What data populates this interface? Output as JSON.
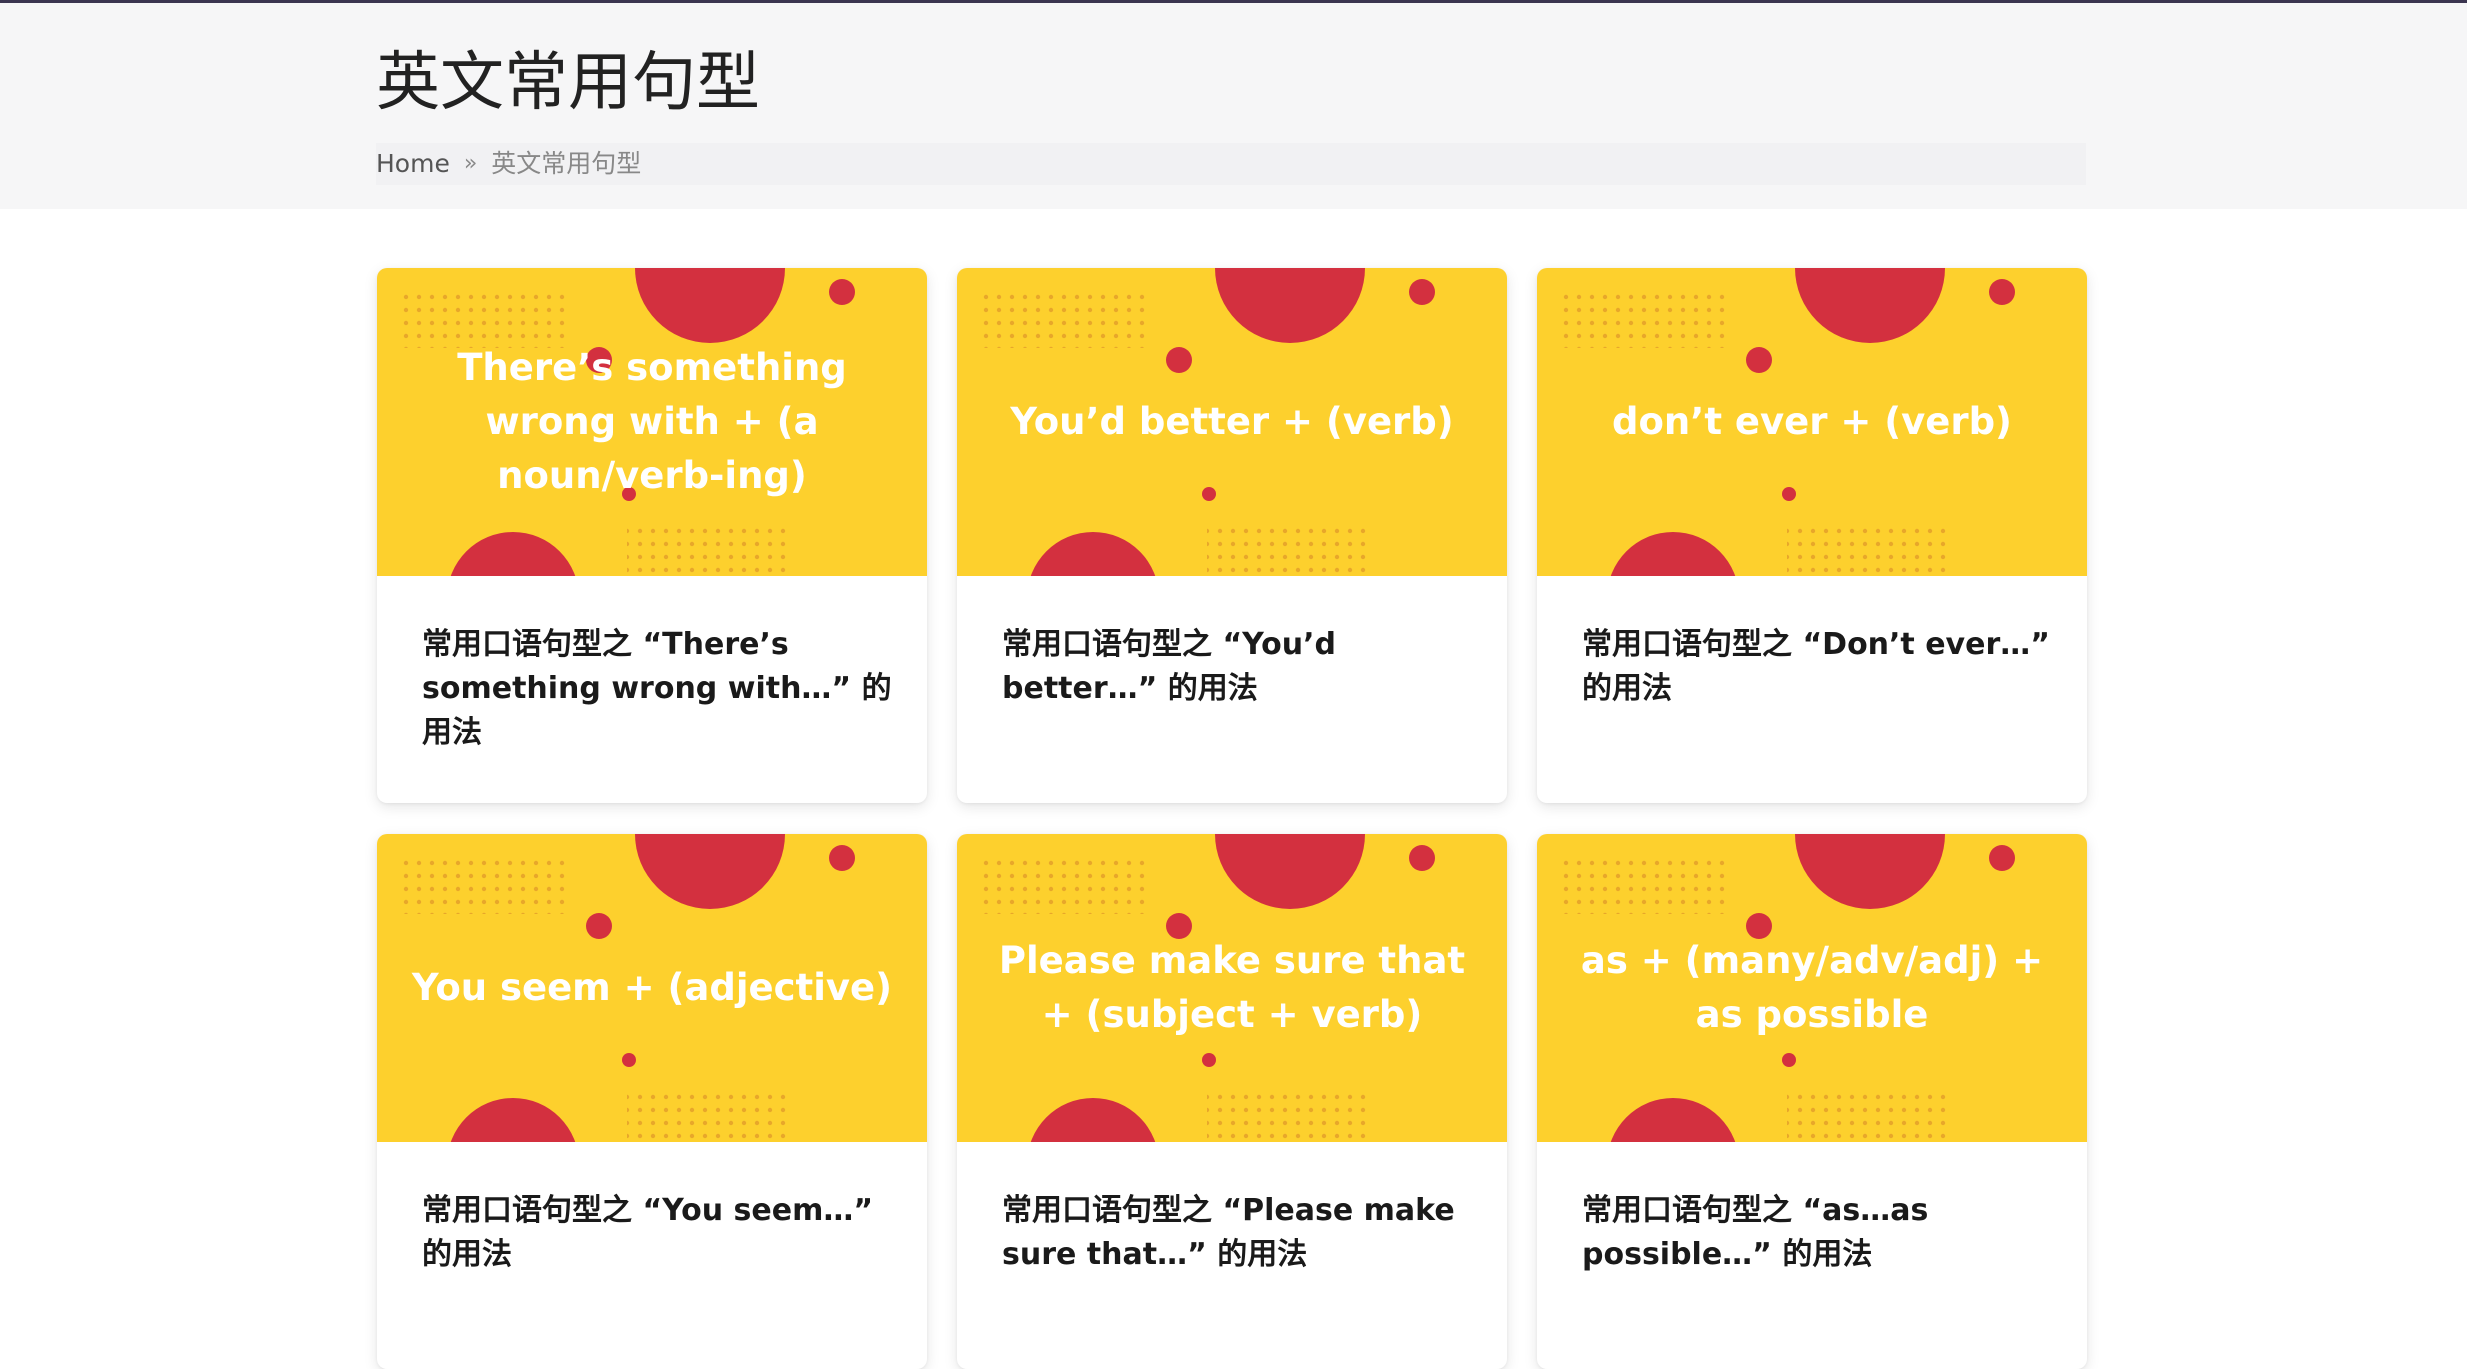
{
  "page": {
    "title": "英文常用句型"
  },
  "breadcrumb": {
    "home": "Home",
    "separator": "»",
    "current": "英文常用句型"
  },
  "colors": {
    "thumb_yellow": "#fdd02d",
    "accent_red": "#d3303f",
    "header_bg": "#f6f6f7"
  },
  "cards": [
    {
      "thumb_text": "There’s something wrong with + (a noun/verb-ing)",
      "title": "常用口语句型之 “There’s something wrong with…” 的用法"
    },
    {
      "thumb_text": "You’d better + (verb)",
      "title": "常用口语句型之 “You’d better…” 的用法"
    },
    {
      "thumb_text": "don’t ever + (verb)",
      "title": "常用口语句型之 “Don’t ever…” 的用法"
    },
    {
      "thumb_text": "You seem + (adjective)",
      "title": "常用口语句型之 “You seem…” 的用法"
    },
    {
      "thumb_text": "Please make sure that + (subject + verb)",
      "title": "常用口语句型之 “Please make sure that…” 的用法"
    },
    {
      "thumb_text": "as + (many/adv/adj) + as possible",
      "title": "常用口语句型之 “as…as possible…” 的用法"
    }
  ]
}
